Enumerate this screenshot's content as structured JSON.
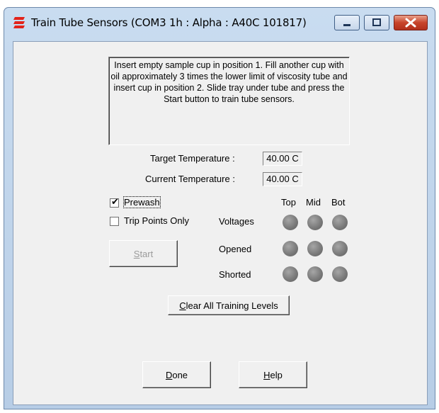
{
  "window": {
    "title": "Train Tube Sensors (COM3 1h : Alpha : A40C 101817)",
    "icon": "red-stripe-app-icon",
    "controls": [
      "minimize-icon",
      "maximize-icon",
      "close-icon"
    ]
  },
  "instructions": "Insert empty sample cup in position 1. Fill another cup with oil approximately 3 times the lower limit of viscosity tube and insert cup in position 2. Slide tray under tube and press the Start button to train tube sensors.",
  "temperatures": {
    "target_label": "Target Temperature :",
    "target_value": "40.00 C",
    "current_label": "Current Temperature :",
    "current_value": "40.00 C"
  },
  "options": {
    "prewash_label": "Prewash",
    "prewash_checked": true,
    "trip_points_label": "Trip Points Only",
    "trip_points_checked": false
  },
  "buttons": {
    "start_pre": "",
    "start_u": "S",
    "start_post": "tart",
    "clear_pre": "",
    "clear_u": "C",
    "clear_post": "lear All Training Levels",
    "done_pre": "",
    "done_u": "D",
    "done_post": "one",
    "help_pre": "",
    "help_u": "H",
    "help_post": "elp"
  },
  "sensors": {
    "columns": [
      "Top",
      "Mid",
      "Bot"
    ],
    "rows": [
      {
        "label": "Voltages",
        "states": [
          "off",
          "off",
          "off"
        ]
      },
      {
        "label": "Opened",
        "states": [
          "off",
          "off",
          "off"
        ]
      },
      {
        "label": "Shorted",
        "states": [
          "off",
          "off",
          "off"
        ]
      }
    ],
    "led_off_color": "#808080"
  }
}
